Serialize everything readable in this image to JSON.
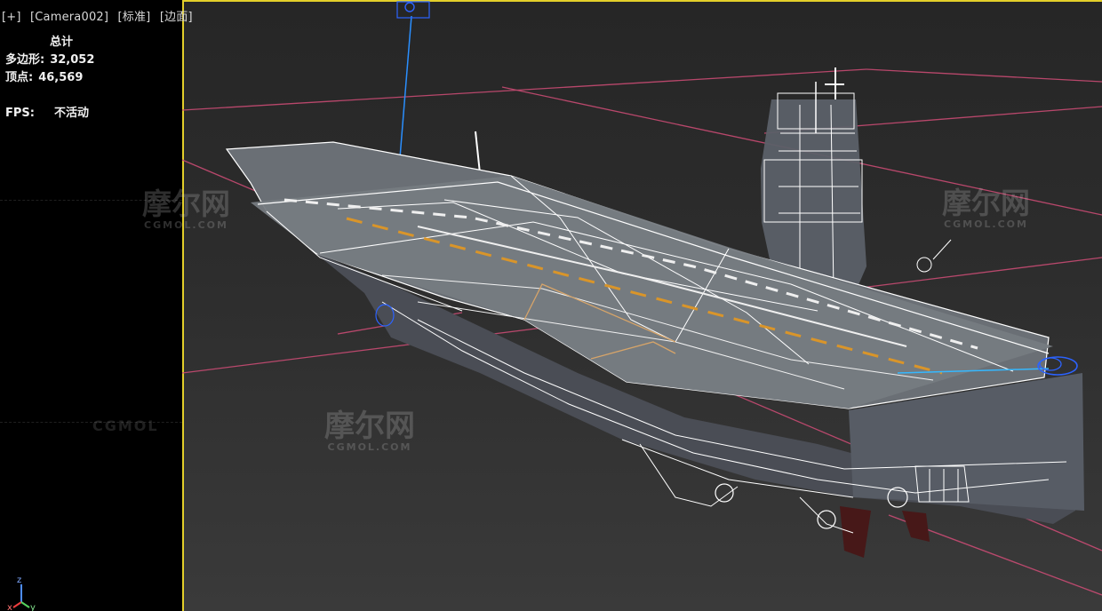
{
  "viewport": {
    "label_parts": [
      "[+]",
      "[Camera002]",
      "[标准]",
      "[边面]"
    ],
    "border_color": "#e3cf2a"
  },
  "stats": {
    "title": "总计",
    "rows": [
      {
        "label": "多边形:",
        "value": "32,052"
      },
      {
        "label": "顶点:",
        "value": "46,569"
      },
      {
        "label": "FPS:",
        "value": "不活动"
      }
    ]
  },
  "watermarks": [
    {
      "text": "摩尔网",
      "subtext": "CGMOL.COM"
    },
    {
      "text": "摩尔网",
      "subtext": "CGMOL.COM"
    },
    {
      "text": "摩尔网",
      "subtext": "CGMOL.COM"
    },
    {
      "text": "CGMOL"
    }
  ],
  "axis": {
    "z_label": "z",
    "x_label": "x",
    "y_label": "y"
  },
  "colors": {
    "grid_pink": "#c84b73",
    "wire_white": "#ffffff",
    "gizmo_blue": "#2c63ff",
    "deck_gray": "#6a6f75",
    "hull_dark": "#4a4d55"
  },
  "icons": {
    "camera_target": "camera-target-icon",
    "axis_gizmo": "axis-gizmo-icon"
  }
}
